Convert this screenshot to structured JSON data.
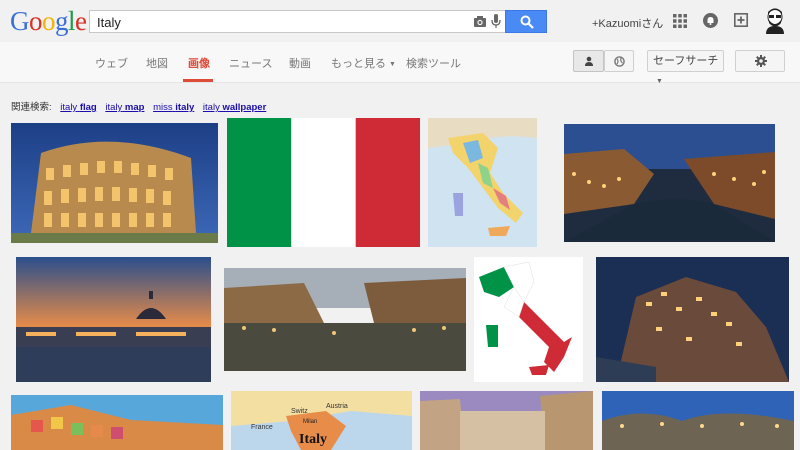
{
  "search": {
    "query": "Italy"
  },
  "user": {
    "name": "+Kazuomiさん"
  },
  "tabs": [
    {
      "label": "ウェブ"
    },
    {
      "label": "地図"
    },
    {
      "label": "画像"
    },
    {
      "label": "ニュース"
    },
    {
      "label": "動画"
    },
    {
      "label": "もっと見る"
    },
    {
      "label": "検索ツール"
    }
  ],
  "tools": {
    "safesearch_label": "セーフサーチ"
  },
  "related": {
    "prefix": "関連検索:",
    "items": [
      {
        "base": "italy",
        "bold": "flag"
      },
      {
        "base": "italy",
        "bold": "map"
      },
      {
        "base": "miss",
        "bold": "italy"
      },
      {
        "base": "italy",
        "bold": "wallpaper"
      }
    ]
  },
  "map_labels": {
    "country": "Italy",
    "neighbor_1": "France",
    "neighbor_2": "Switz",
    "neighbor_3": "Austria",
    "neighbor_4": "Milan"
  },
  "colors": {
    "accent": "#dd4b39",
    "search_blue": "#4a8af4",
    "link": "#1a0dab",
    "flag_green": "#009246",
    "flag_red": "#ce2b37"
  }
}
